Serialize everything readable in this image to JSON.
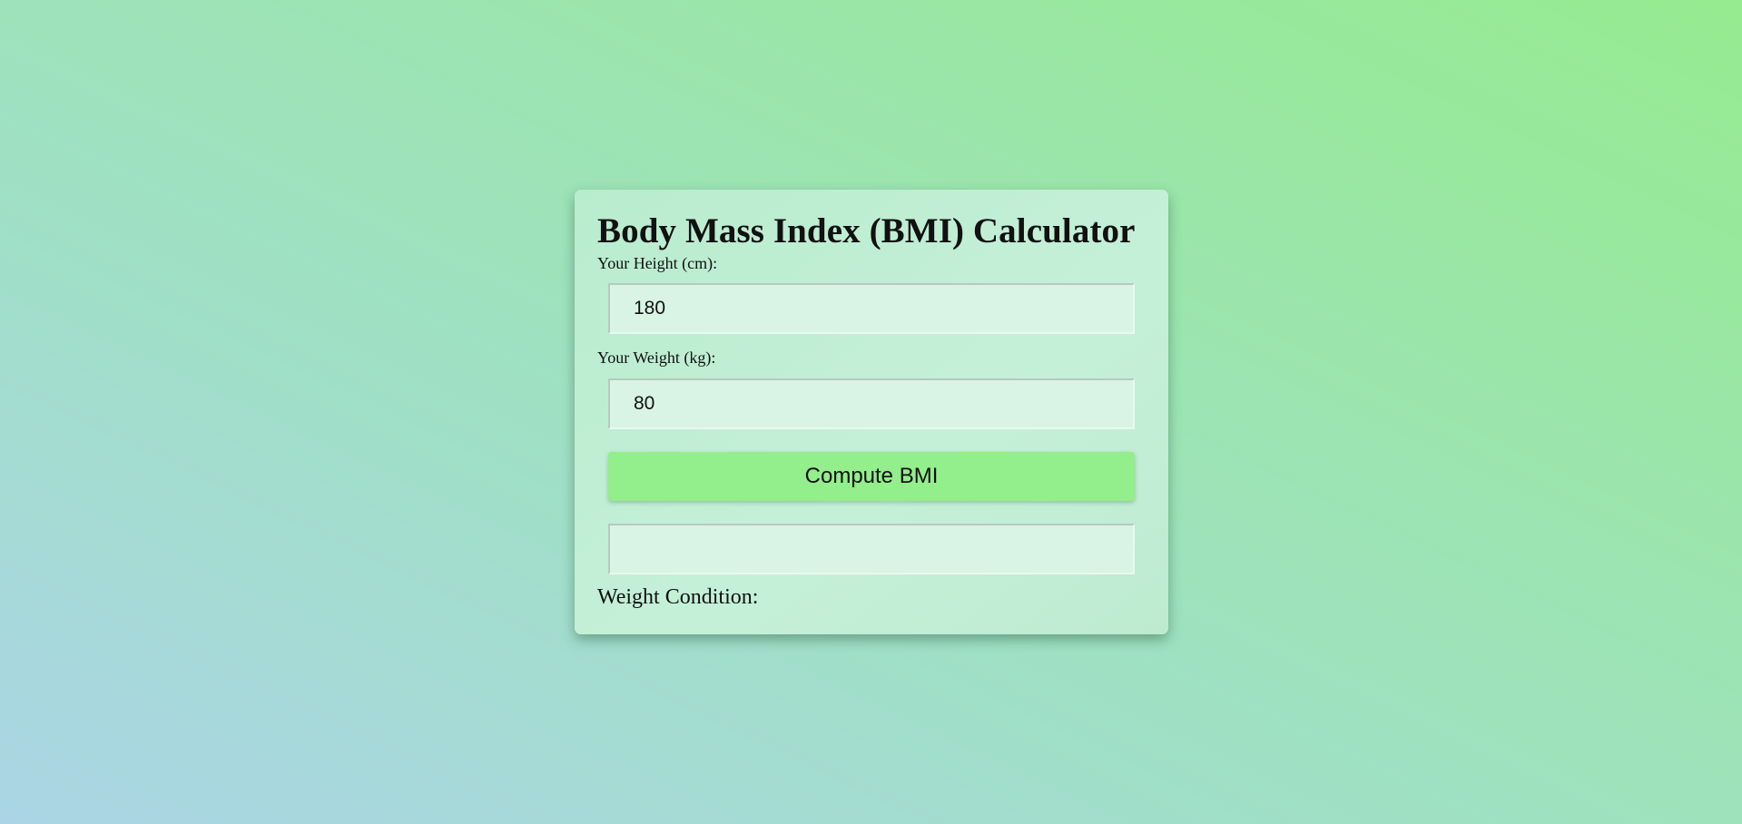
{
  "calculator": {
    "title": "Body Mass Index (BMI) Calculator",
    "height_label": "Your Height (cm):",
    "height_value": "180",
    "weight_label": "Your Weight (kg):",
    "weight_value": "80",
    "compute_button_label": "Compute BMI",
    "result_value": "",
    "condition_label": "Weight Condition:"
  },
  "colors": {
    "button_background": "#93ee8c",
    "card_background": "#c0eed4",
    "input_background": "#d9f4e4",
    "page_gradient_start": "#abd5e6",
    "page_gradient_end": "#96eb90"
  }
}
